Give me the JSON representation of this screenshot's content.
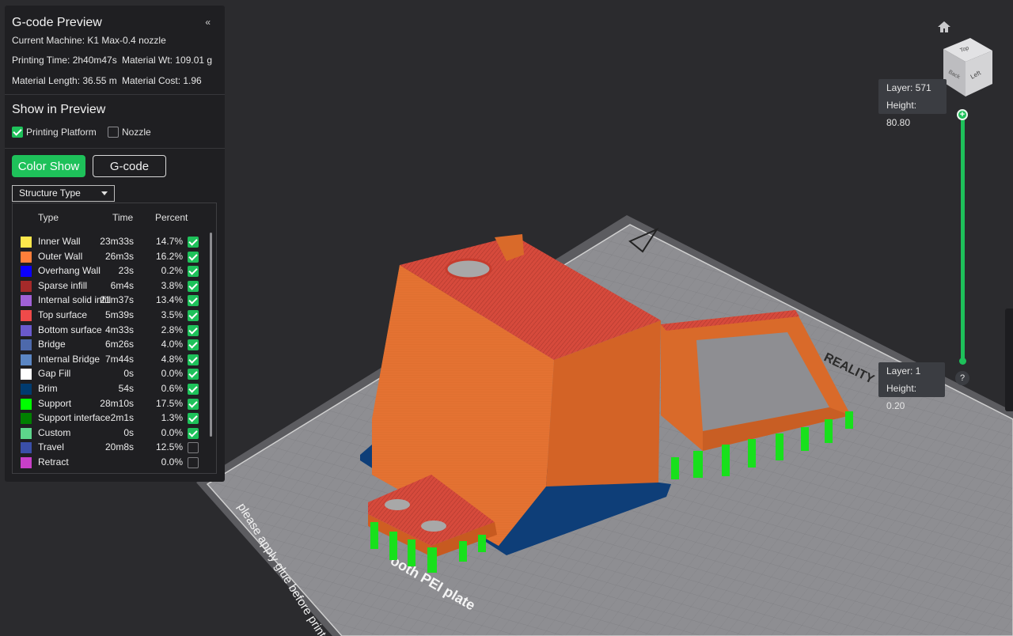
{
  "panel": {
    "title": "G-code Preview",
    "collapse_glyph": "«",
    "machine": "Current Machine: K1 Max-0.4 nozzle",
    "printing_time": "Printing Time: 2h40m47s",
    "material_wt": "Material Wt: 109.01 g",
    "material_length": "Material Length: 36.55 m",
    "material_cost": "Material Cost: 1.96"
  },
  "show_in_preview": {
    "title": "Show in Preview",
    "printing_platform": {
      "label": "Printing Platform",
      "checked": true
    },
    "nozzle": {
      "label": "Nozzle",
      "checked": false
    }
  },
  "buttons": {
    "color_show": "Color Show",
    "gcode": "G-code"
  },
  "structure_select": {
    "value": "Structure Type"
  },
  "legend": {
    "headers": {
      "type": "Type",
      "time": "Time",
      "percent": "Percent"
    },
    "rows": [
      {
        "type": "Inner Wall",
        "time": "23m33s",
        "percent": "14.7%",
        "color": "#fde74c",
        "checked": true
      },
      {
        "type": "Outer Wall",
        "time": "26m3s",
        "percent": "16.2%",
        "color": "#ff7f3a",
        "checked": true
      },
      {
        "type": "Overhang Wall",
        "time": "23s",
        "percent": "0.2%",
        "color": "#0b00ff",
        "checked": true
      },
      {
        "type": "Sparse infill",
        "time": "6m4s",
        "percent": "3.8%",
        "color": "#a52a2a",
        "checked": true
      },
      {
        "type": "Internal solid infill",
        "time": "21m37s",
        "percent": "13.4%",
        "color": "#a061d6",
        "checked": true
      },
      {
        "type": "Top surface",
        "time": "5m39s",
        "percent": "3.5%",
        "color": "#ef4a4a",
        "checked": true
      },
      {
        "type": "Bottom surface",
        "time": "4m33s",
        "percent": "2.8%",
        "color": "#6a5acd",
        "checked": true
      },
      {
        "type": "Bridge",
        "time": "6m26s",
        "percent": "4.0%",
        "color": "#4d69ab",
        "checked": true
      },
      {
        "type": "Internal Bridge",
        "time": "7m44s",
        "percent": "4.8%",
        "color": "#5b86c4",
        "checked": true
      },
      {
        "type": "Gap Fill",
        "time": "0s",
        "percent": "0.0%",
        "color": "#ffffff",
        "checked": true
      },
      {
        "type": "Brim",
        "time": "54s",
        "percent": "0.6%",
        "color": "#003b6f",
        "checked": true
      },
      {
        "type": "Support",
        "time": "28m10s",
        "percent": "17.5%",
        "color": "#00ff00",
        "checked": true
      },
      {
        "type": "Support interface",
        "time": "2m1s",
        "percent": "1.3%",
        "color": "#008000",
        "checked": true
      },
      {
        "type": "Custom",
        "time": "0s",
        "percent": "0.0%",
        "color": "#5dd68b",
        "checked": true
      },
      {
        "type": "Travel",
        "time": "20m8s",
        "percent": "12.5%",
        "color": "#3a4fa8",
        "checked": false
      },
      {
        "type": "Retract",
        "time": "",
        "percent": "0.0%",
        "color": "#c83fc8",
        "checked": false
      }
    ]
  },
  "layer_slider": {
    "top": {
      "layer": "Layer: 571",
      "height": "Height: 80.80"
    },
    "bottom": {
      "layer": "Layer: 1",
      "height": "Height: 0.20"
    },
    "help": "?"
  },
  "view_cube": {
    "top": "Top",
    "back": "Back",
    "left": "Left"
  },
  "plate": {
    "brand": "REALITY",
    "bottom_text_1": "please apply glue before print",
    "bottom_text_2": "ooth PEI plate"
  },
  "icons": [
    "home-icon",
    "view-cube",
    "plus-icon"
  ],
  "colors": {
    "accent": "#1ec15a",
    "panel": "#1f1f22",
    "background": "#2b2b2e",
    "model": "#e5742f",
    "top": "#d8473e",
    "support": "#18e01c"
  }
}
